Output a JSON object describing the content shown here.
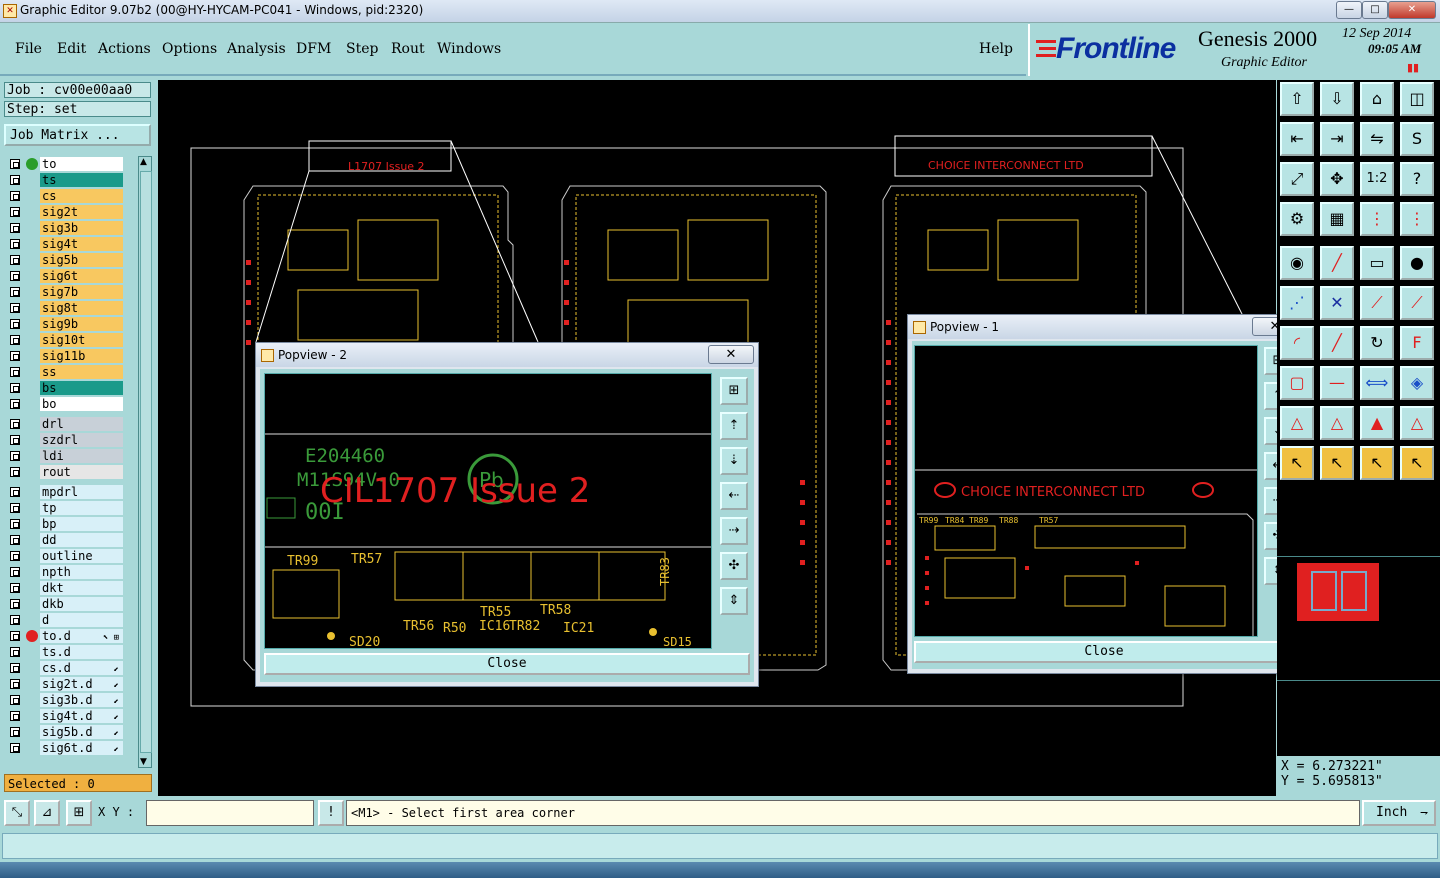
{
  "window": {
    "title": "Graphic Editor 9.07b2 (00@HY-HYCAM-PC041 - Windows, pid:2320)",
    "min": "—",
    "max": "□",
    "close": "✕"
  },
  "menu": [
    {
      "label": "File"
    },
    {
      "label": "Edit"
    },
    {
      "label": "Actions"
    },
    {
      "label": "Options"
    },
    {
      "label": "Analysis"
    },
    {
      "label": "DFM"
    },
    {
      "label": "Step"
    },
    {
      "label": "Rout"
    },
    {
      "label": "Windows"
    }
  ],
  "help": "Help",
  "brand": {
    "logo": "Frontline",
    "product": "Genesis 2000",
    "subtitle": "Graphic Editor",
    "date": "12 Sep 2014",
    "time": "09:05 AM"
  },
  "job": {
    "job_label": "Job : cv00e00aa0",
    "step_label": "Step: set",
    "matrix_button": "Job Matrix ..."
  },
  "layers_group1": [
    {
      "name": "to",
      "color": "#ffffff",
      "dot": "#2a9d2a"
    },
    {
      "name": "ts",
      "color": "#1a9a8a",
      "dot": ""
    },
    {
      "name": "cs",
      "color": "#f8c860",
      "dot": ""
    },
    {
      "name": "sig2t",
      "color": "#f8c860",
      "dot": ""
    },
    {
      "name": "sig3b",
      "color": "#f8c860",
      "dot": ""
    },
    {
      "name": "sig4t",
      "color": "#f8c860",
      "dot": ""
    },
    {
      "name": "sig5b",
      "color": "#f8c860",
      "dot": ""
    },
    {
      "name": "sig6t",
      "color": "#f8c860",
      "dot": ""
    },
    {
      "name": "sig7b",
      "color": "#f8c860",
      "dot": ""
    },
    {
      "name": "sig8t",
      "color": "#f8c860",
      "dot": ""
    },
    {
      "name": "sig9b",
      "color": "#f8c860",
      "dot": ""
    },
    {
      "name": "sig10t",
      "color": "#f8c860",
      "dot": ""
    },
    {
      "name": "sig11b",
      "color": "#f8c860",
      "dot": ""
    },
    {
      "name": "ss",
      "color": "#f8c860",
      "dot": ""
    },
    {
      "name": "bs",
      "color": "#1a9a8a",
      "dot": ""
    },
    {
      "name": "bo",
      "color": "#ffffff",
      "dot": ""
    }
  ],
  "layers_group2": [
    {
      "name": "drl",
      "color": "#c8d0d8"
    },
    {
      "name": "szdrl",
      "color": "#c8d0d8"
    },
    {
      "name": "ldi",
      "color": "#c8d0d8"
    },
    {
      "name": "rout",
      "color": "#e6e6e6"
    }
  ],
  "layers_group3": [
    {
      "name": "mpdrl",
      "color": "#d8f0f8",
      "dot": "",
      "arr": ""
    },
    {
      "name": "tp",
      "color": "#d8f0f8",
      "dot": "",
      "arr": ""
    },
    {
      "name": "bp",
      "color": "#d8f0f8",
      "dot": "",
      "arr": ""
    },
    {
      "name": "dd",
      "color": "#d8f0f8",
      "dot": "",
      "arr": ""
    },
    {
      "name": "outline",
      "color": "#d8f0f8",
      "dot": "",
      "arr": ""
    },
    {
      "name": "npth",
      "color": "#d8f0f8",
      "dot": "",
      "arr": ""
    },
    {
      "name": "dkt",
      "color": "#d8f0f8",
      "dot": "",
      "arr": ""
    },
    {
      "name": "dkb",
      "color": "#d8f0f8",
      "dot": "",
      "arr": ""
    },
    {
      "name": "d",
      "color": "#d8f0f8",
      "dot": "",
      "arr": ""
    },
    {
      "name": "to.d",
      "color": "#d8f0f8",
      "dot": "#e02020",
      "arr": "⬉ ⊞"
    },
    {
      "name": "ts.d",
      "color": "#d8f0f8",
      "dot": "",
      "arr": ""
    },
    {
      "name": "cs.d",
      "color": "#d8f0f8",
      "dot": "",
      "arr": "⬋"
    },
    {
      "name": "sig2t.d",
      "color": "#d8f0f8",
      "dot": "",
      "arr": "⬋"
    },
    {
      "name": "sig3b.d",
      "color": "#d8f0f8",
      "dot": "",
      "arr": "⬋"
    },
    {
      "name": "sig4t.d",
      "color": "#d8f0f8",
      "dot": "",
      "arr": "⬋"
    },
    {
      "name": "sig5b.d",
      "color": "#d8f0f8",
      "dot": "",
      "arr": "⬋"
    },
    {
      "name": "sig6t.d",
      "color": "#d8f0f8",
      "dot": "",
      "arr": "⬋"
    }
  ],
  "selected": "Selected : 0",
  "coords": {
    "x": "X = 6.273221\"",
    "y": "Y = 5.695813\""
  },
  "bottom": {
    "xy_label": "X Y :",
    "xy_value": "",
    "prompt": "<M1> - Select first area corner",
    "unit": "Inch"
  },
  "board": {
    "top_text_1": "L1707 Issue 2",
    "top_text_2": "CHOICE INTERCONNECT LTD"
  },
  "popview2": {
    "title": "Popview - 2",
    "close": "Close",
    "labels": [
      "E204460",
      "M11S94V-0",
      "CIL1707 Issue 2",
      "Pb",
      "00I",
      "TR99",
      "TR57",
      "TR55",
      "TR58",
      "TR56",
      "R50",
      "IC16",
      "TR82",
      "IC21",
      "SD20",
      "SD15",
      "TR83"
    ]
  },
  "popview1": {
    "title": "Popview - 1",
    "close": "Close",
    "labels": [
      "CHOICE INTERCONNECT LTD",
      "TR99",
      "TR84",
      "TR89",
      "TR88",
      "TR57"
    ]
  },
  "colors": {
    "panel": "#a8d8d8",
    "canvas": "#000000",
    "board_red": "#e02020",
    "board_yellow": "#e8c030",
    "green_text": "#3a9a3a"
  }
}
